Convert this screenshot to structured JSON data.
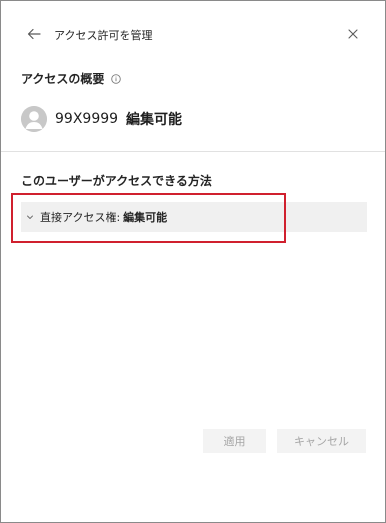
{
  "header": {
    "title": "アクセス許可を管理",
    "back_icon": "arrow-left-icon",
    "close_icon": "close-icon"
  },
  "overview": {
    "heading": "アクセスの概要",
    "info_icon": "info-icon"
  },
  "user": {
    "name": "99X9999",
    "permission": "編集可能",
    "avatar_icon": "person-avatar-icon"
  },
  "methods": {
    "heading": "このユーザーがアクセスできる方法",
    "items": [
      {
        "label": "直接アクセス権:",
        "value": "編集可能",
        "expand_icon": "chevron-down-icon"
      }
    ]
  },
  "footer": {
    "apply_label": "適用",
    "cancel_label": "キャンセル"
  },
  "colors": {
    "highlight": "#d0202e",
    "row_background": "#f0f0f0",
    "button_background": "#f3f3f3",
    "button_disabled_text": "#a6a6a6"
  }
}
